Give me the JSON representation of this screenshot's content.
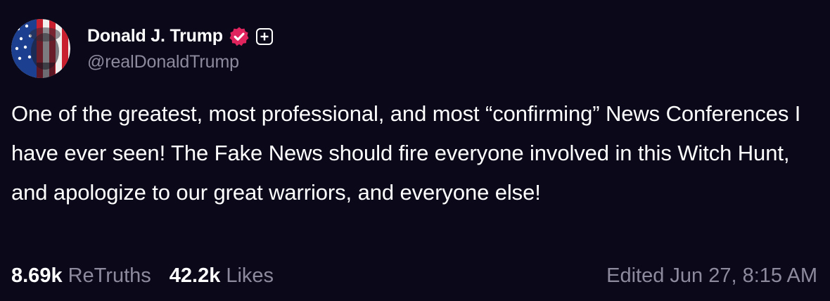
{
  "post": {
    "author": {
      "display_name": "Donald J. Trump",
      "handle": "@realDonaldTrump",
      "verified": true,
      "verified_color": "#e0245e"
    },
    "text": "One of the greatest, most professional, and most “confirming” News Conferences I have ever seen! The Fake News should fire everyone involved in this Witch Hunt, and apologize to our great warriors, and everyone else!",
    "stats": {
      "retruths_count": "8.69k",
      "retruths_label": "ReTruths",
      "likes_count": "42.2k",
      "likes_label": "Likes"
    },
    "edited_label": "Edited Jun 27, 8:15 AM"
  },
  "colors": {
    "background": "#0b0919",
    "primary_text": "#ffffff",
    "secondary_text": "#8d8a9e"
  },
  "icons": {
    "avatar": "profile-photo",
    "verified": "verified-badge-icon",
    "plus": "plus-badge-icon"
  }
}
